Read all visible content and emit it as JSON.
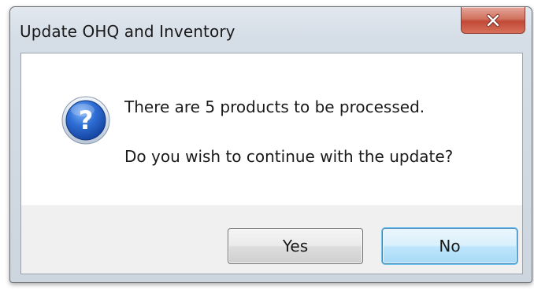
{
  "window": {
    "title": "Update OHQ and Inventory",
    "close_icon": "close-icon"
  },
  "message": {
    "icon": "question-icon",
    "icon_glyph": "?",
    "line1": "There are 5 products to be processed.",
    "line2": "Do you wish to continue with the update?"
  },
  "buttons": {
    "yes_label": "Yes",
    "no_label": "No"
  },
  "colors": {
    "close_button": "#c14a37",
    "question_icon": "#1c5bbd",
    "default_button": "#bee6fd"
  }
}
